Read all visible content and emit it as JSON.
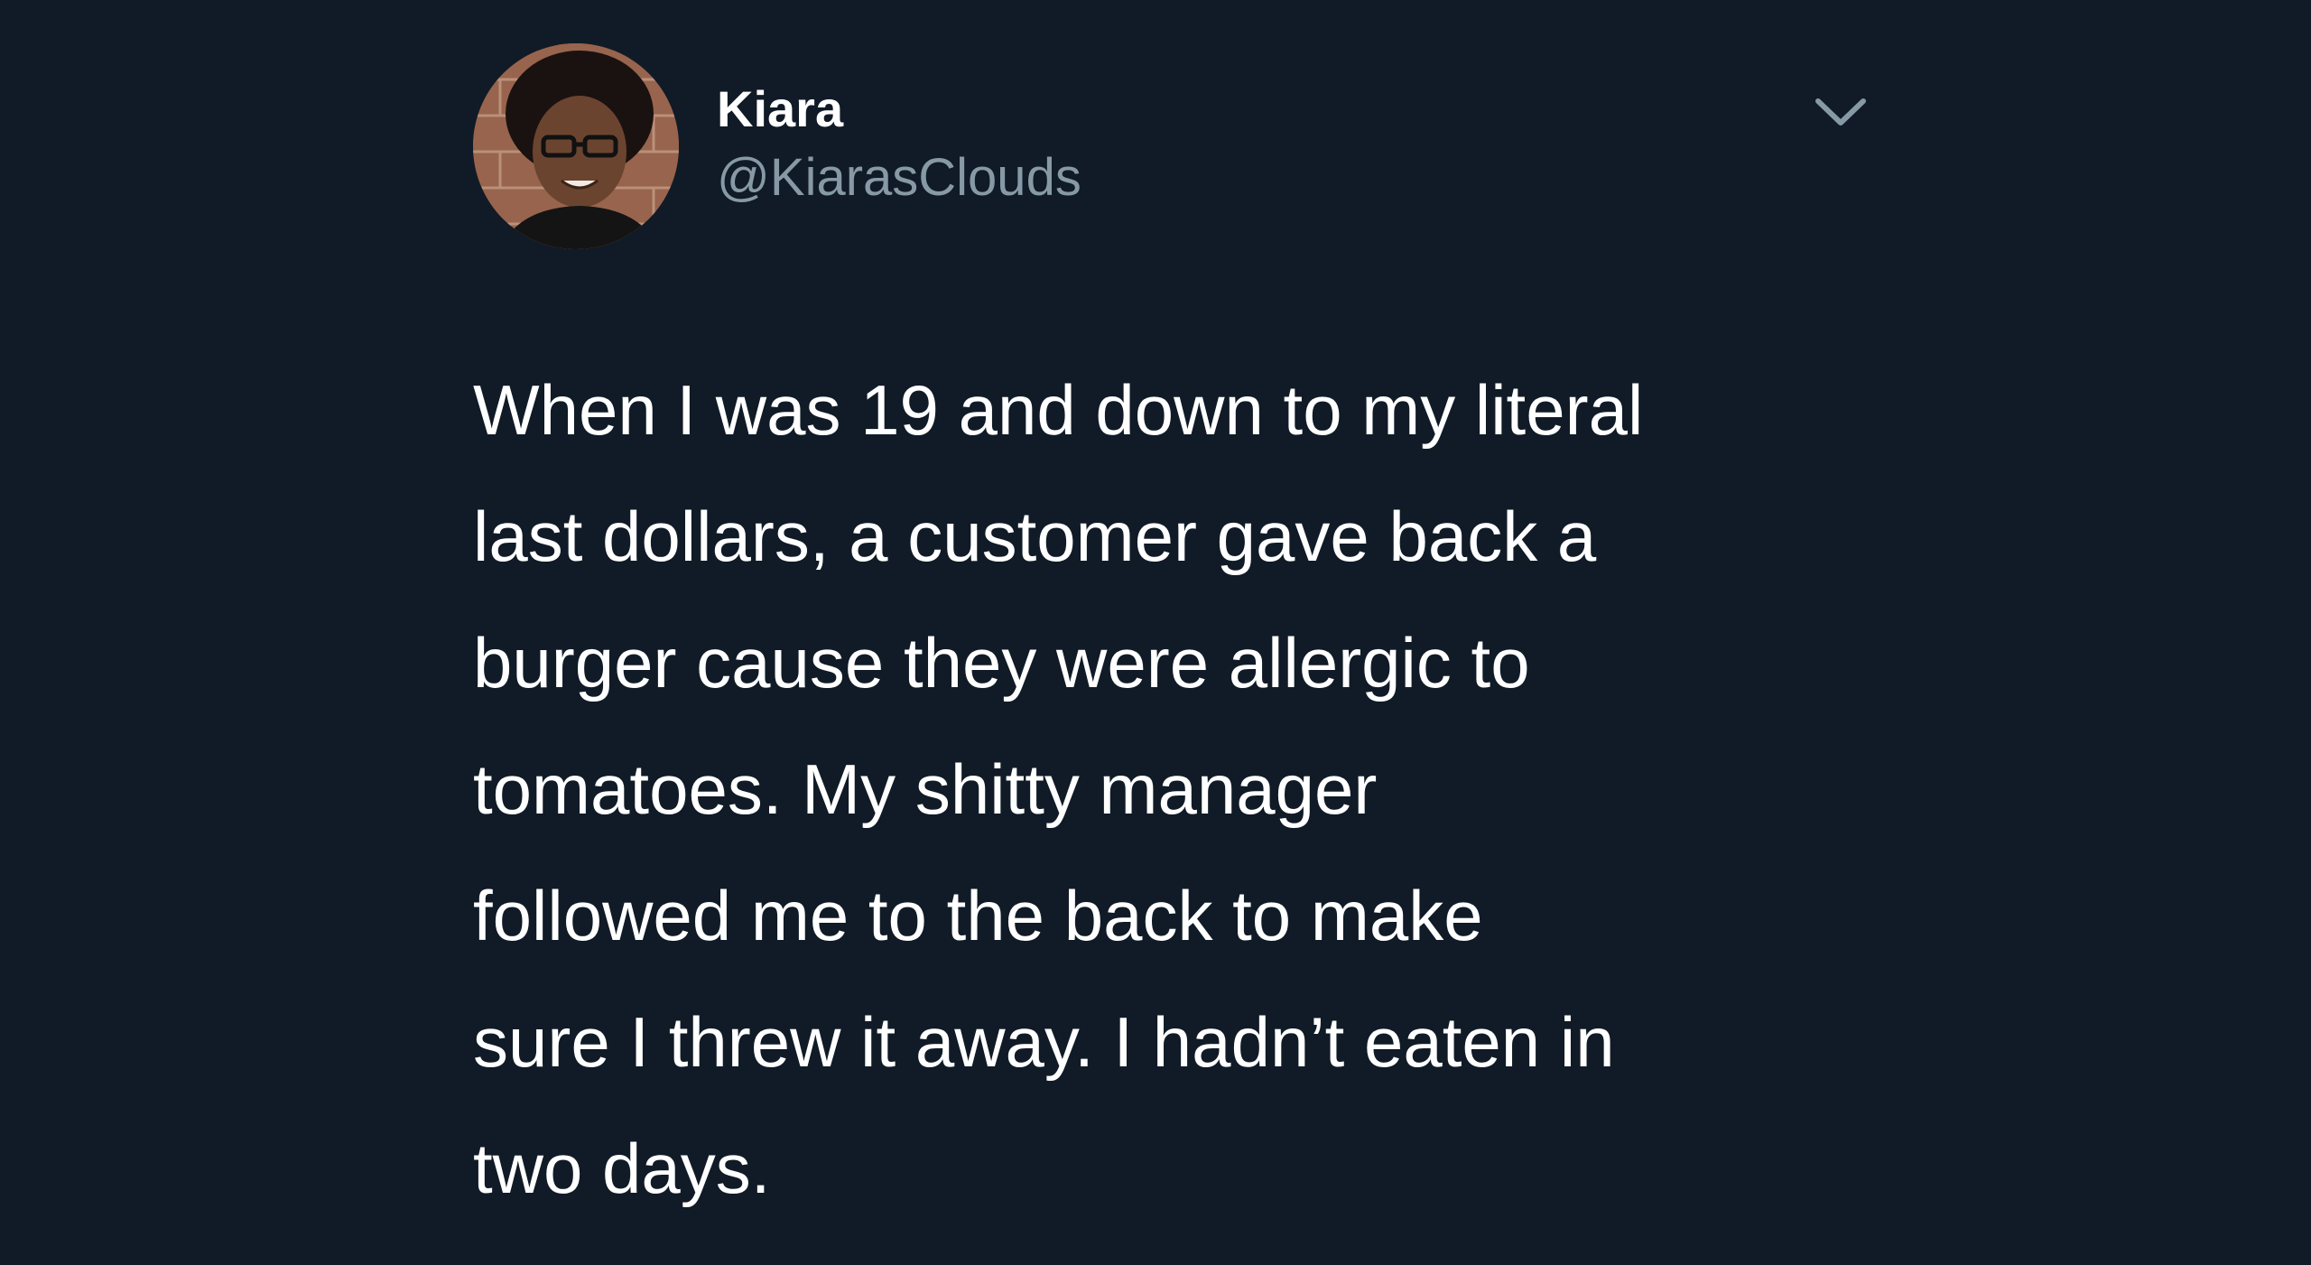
{
  "tweet": {
    "author": {
      "display_name": "Kiara",
      "handle": "@KiarasClouds",
      "avatar_icon": "profile-photo"
    },
    "menu_icon": "chevron-down-icon",
    "text_lines": [
      "When I was 19 and down to my literal",
      "last dollars, a customer gave back a",
      "burger cause they were allergic to",
      "tomatoes. My shitty manager",
      "followed me to the back to make",
      "sure I threw it away. I hadn’t eaten in",
      "two days."
    ]
  },
  "colors": {
    "background": "#101b27",
    "text": "#ffffff",
    "secondary_text": "#8899a6"
  }
}
